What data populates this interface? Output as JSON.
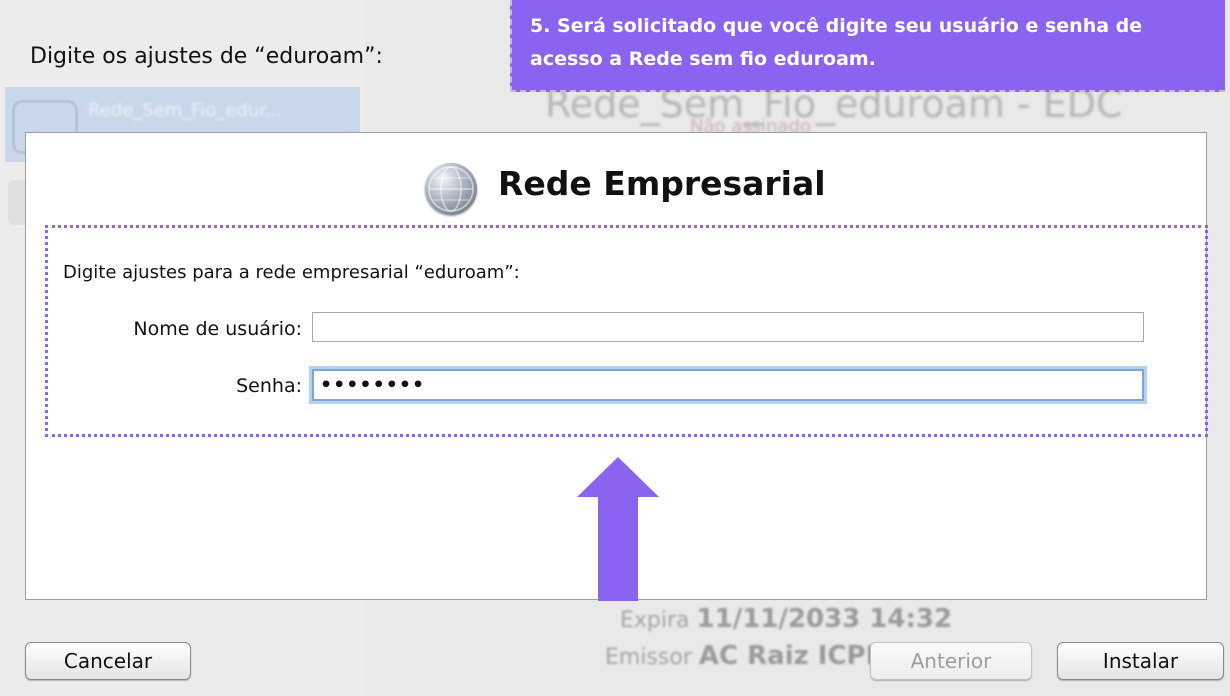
{
  "background": {
    "selected_item": "Rede_Sem_Fio_edur...",
    "main_title": "Rede_Sem_Fio_eduroam - EDC",
    "main_subtitle": "Não assinado",
    "expiry_label": "Expira",
    "expiry_value": "11/11/2033 14:32",
    "issuer_label": "Emissor",
    "issuer_value": "AC Raiz ICPE..."
  },
  "dialog": {
    "heading": "Digite os ajustes de “eduroam”:",
    "panel_title": "Rede Empresarial",
    "prompt": "Digite ajustes para a rede empresarial “eduroam”:",
    "username_label": "Nome de usuário:",
    "username_value": "",
    "password_label": "Senha:",
    "password_value": "••••••••"
  },
  "callout": {
    "text": "5. Será solicitado que você digite seu usuário e senha de acesso a Rede sem fio eduroam."
  },
  "buttons": {
    "cancel": "Cancelar",
    "previous": "Anterior",
    "install": "Instalar"
  },
  "colors": {
    "accent": "#8a63f1",
    "focus_ring": "#7fa6d6"
  },
  "icons": {
    "panel_icon": "network-globe-icon",
    "annotation": "arrow-up-icon"
  }
}
